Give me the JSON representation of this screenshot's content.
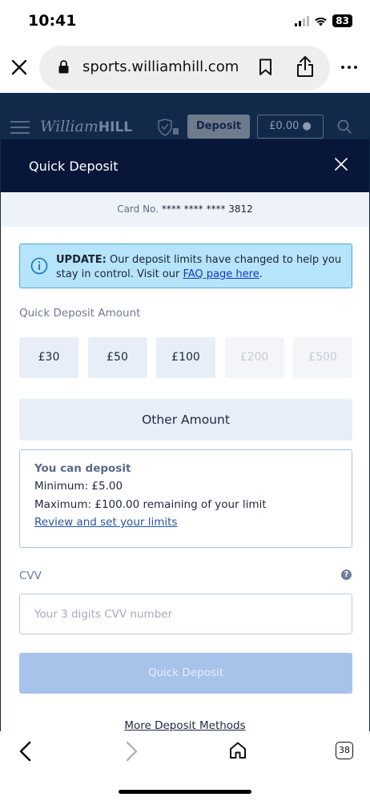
{
  "status_bar": {
    "time": "10:41",
    "battery": "83"
  },
  "browser": {
    "url": "sports.williamhill.com",
    "open_tabs": "38"
  },
  "site_header": {
    "logo_script": "William",
    "logo_bold": "HILL",
    "deposit_label": "Deposit",
    "balance": "£0.00"
  },
  "modal": {
    "title": "Quick Deposit",
    "card_label": "Card No.",
    "card_number": "**** **** **** 3812",
    "notice": {
      "bold": "UPDATE:",
      "text": " Our deposit limits have changed to help you stay in control. Visit our ",
      "link": "FAQ page here",
      "end": "."
    },
    "amount_label": "Quick Deposit Amount",
    "amounts": [
      {
        "label": "£30",
        "enabled": true
      },
      {
        "label": "£50",
        "enabled": true
      },
      {
        "label": "£100",
        "enabled": true
      },
      {
        "label": "£200",
        "enabled": false
      },
      {
        "label": "£500",
        "enabled": false
      }
    ],
    "other_amount": "Other Amount",
    "limits": {
      "heading": "You can deposit",
      "minimum": "Minimum: £5.00",
      "maximum": "Maximum: £100.00 remaining of your limit",
      "link": "Review and set your limits"
    },
    "cvv": {
      "label": "CVV",
      "help": "?",
      "placeholder": "Your 3 digits CVV number",
      "value": ""
    },
    "submit_label": "Quick Deposit",
    "more_methods": "More Deposit Methods"
  },
  "colors": {
    "header_bg": "#08163a",
    "site_header_bg": "#132949",
    "amount_bg": "#e8eef8",
    "notice_bg": "#b6e4fa",
    "submit_disabled_bg": "#a8c3ea"
  }
}
